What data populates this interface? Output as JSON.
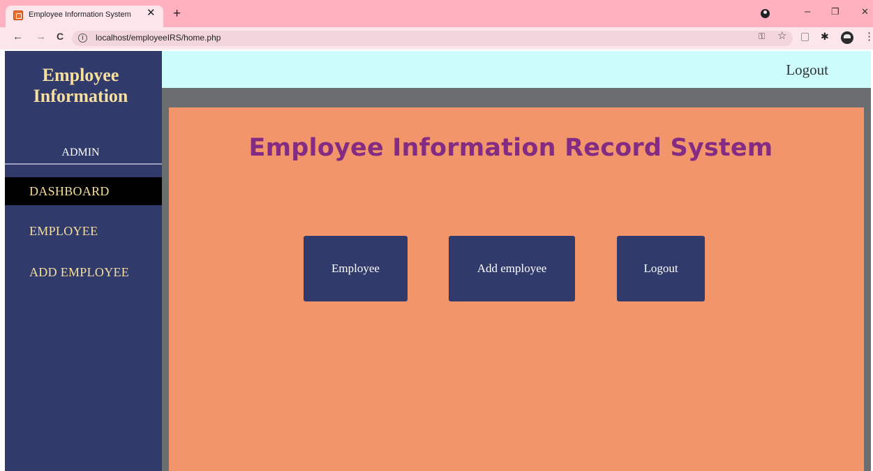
{
  "browser": {
    "tab_title": "Employee Information System",
    "tab_close": "✕",
    "new_tab": "+",
    "url": "localhost/employeeIRS/home.php",
    "window_minimize": "–",
    "window_restore": "❐",
    "window_close": "✕",
    "nav_back": "←",
    "nav_forward": "→",
    "nav_reload": "C",
    "info": "i",
    "key_icon": "⚿",
    "star_icon": "☆",
    "puzzle_icon": "✱",
    "menu_icon": "⋮"
  },
  "sidebar": {
    "brand_line1": "Employee",
    "brand_line2": "Information",
    "role": "ADMIN",
    "items": [
      {
        "label": "DASHBOARD",
        "active": true
      },
      {
        "label": "EMPLOYEE",
        "active": false
      },
      {
        "label": "ADD EMPLOYEE",
        "active": false
      }
    ]
  },
  "header": {
    "logout": "Logout"
  },
  "main": {
    "title": "Employee Information Record System",
    "buttons": [
      {
        "label": "Employee"
      },
      {
        "label": "Add employee"
      },
      {
        "label": "Logout"
      }
    ]
  },
  "colors": {
    "sidebar_bg": "#303b6b",
    "sidebar_text": "#f7dfa0",
    "panel_bg": "#f2956b",
    "title_color": "#842c84",
    "topbar_bg": "#cdfcfc",
    "tabstrip_bg": "#ffb1c0"
  }
}
